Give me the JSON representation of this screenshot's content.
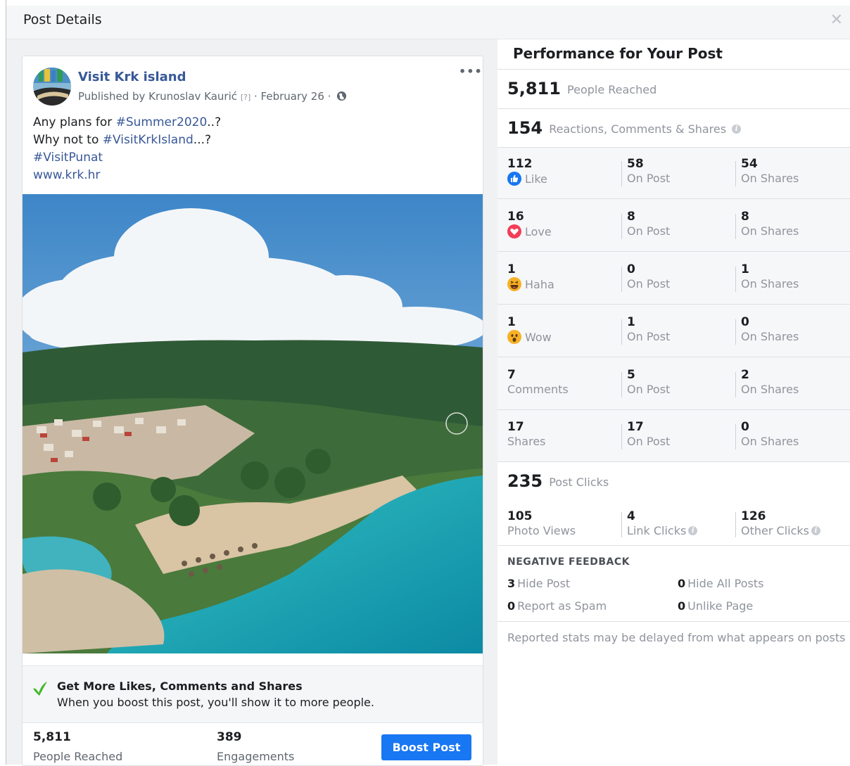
{
  "dialog": {
    "title": "Post Details",
    "close_icon": "close-icon"
  },
  "post": {
    "page_name": "Visit Krk island",
    "published_by": "Published by Krunoslav Kaurić",
    "q_marker": "[?]",
    "date_suffix": " · February 26 · ",
    "more_label": "•••",
    "text": {
      "line1_prefix": "Any plans for ",
      "line1_tag": "#Summer2020",
      "line1_suffix": "..?",
      "line2_prefix": "Why not to ",
      "line2_tag": "#VisitKrkIsland",
      "line2_suffix": "...?",
      "line3_tag": "#VisitPunat",
      "line4_link": "www.krk.hr"
    }
  },
  "boost": {
    "title": "Get More Likes, Comments and Shares",
    "subtitle": "When you boost this post, you'll show it to more people.",
    "reached_value": "5,811",
    "reached_label": "People Reached",
    "engagements_value": "389",
    "engagements_label": "Engagements",
    "button_label": "Boost Post"
  },
  "performance": {
    "title": "Performance for Your Post",
    "people_reached": {
      "value": "5,811",
      "label": "People Reached"
    },
    "reactions_total": {
      "value": "154",
      "label": "Reactions, Comments & Shares"
    },
    "rows": [
      {
        "total": "112",
        "label": "Like",
        "icon": "like-icon",
        "on_post": "58",
        "on_post_label": "On Post",
        "on_shares": "54",
        "on_shares_label": "On Shares"
      },
      {
        "total": "16",
        "label": "Love",
        "icon": "love-icon",
        "on_post": "8",
        "on_post_label": "On Post",
        "on_shares": "8",
        "on_shares_label": "On Shares"
      },
      {
        "total": "1",
        "label": "Haha",
        "icon": "haha-icon",
        "on_post": "0",
        "on_post_label": "On Post",
        "on_shares": "1",
        "on_shares_label": "On Shares"
      },
      {
        "total": "1",
        "label": "Wow",
        "icon": "wow-icon",
        "on_post": "1",
        "on_post_label": "On Post",
        "on_shares": "0",
        "on_shares_label": "On Shares"
      },
      {
        "total": "7",
        "label": "Comments",
        "icon": "",
        "on_post": "5",
        "on_post_label": "On Post",
        "on_shares": "2",
        "on_shares_label": "On Shares"
      },
      {
        "total": "17",
        "label": "Shares",
        "icon": "",
        "on_post": "17",
        "on_post_label": "On Post",
        "on_shares": "0",
        "on_shares_label": "On Shares"
      }
    ],
    "post_clicks": {
      "value": "235",
      "label": "Post Clicks"
    },
    "clicks": [
      {
        "value": "105",
        "label": "Photo Views"
      },
      {
        "value": "4",
        "label": "Link Clicks"
      },
      {
        "value": "126",
        "label": "Other Clicks"
      }
    ],
    "negative_feedback": {
      "title": "NEGATIVE FEEDBACK",
      "hide_post": {
        "value": "3",
        "label": "Hide Post"
      },
      "hide_all": {
        "value": "0",
        "label": "Hide All Posts"
      },
      "report_spam": {
        "value": "0",
        "label": "Report as Spam"
      },
      "unlike_page": {
        "value": "0",
        "label": "Unlike Page"
      }
    },
    "note": "Reported stats may be delayed from what appears on posts",
    "info_glyph": "i"
  },
  "colors": {
    "link": "#385898",
    "accent": "#1877f2",
    "muted": "#90949c"
  }
}
